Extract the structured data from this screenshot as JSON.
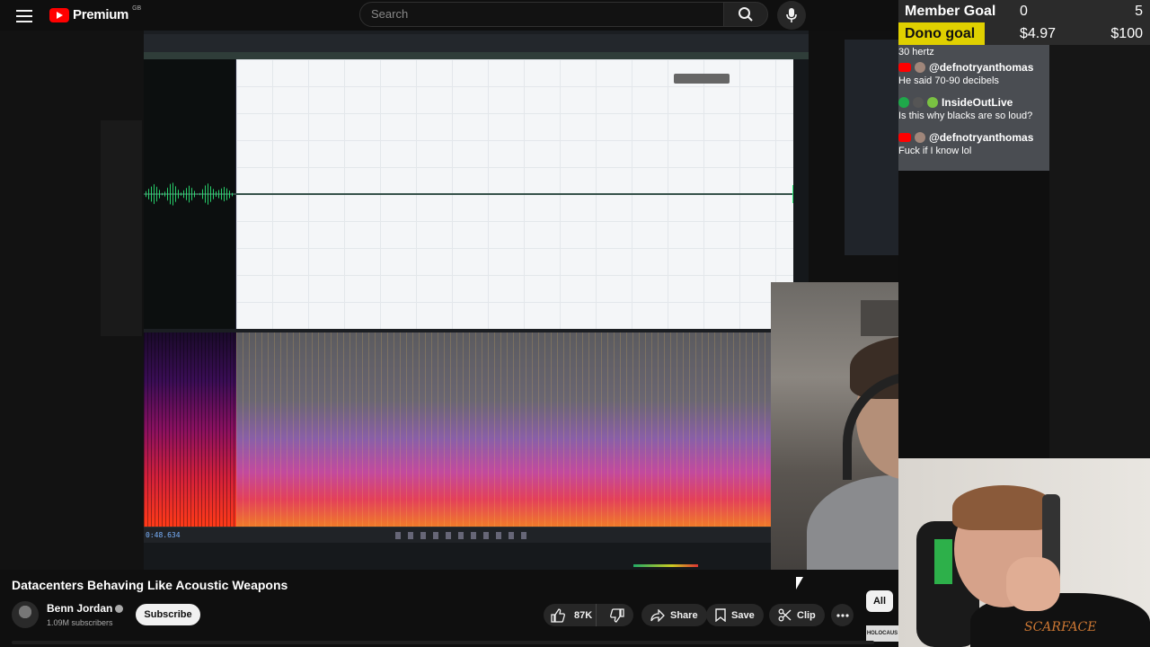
{
  "header": {
    "logo_text": "Premium",
    "region": "GB",
    "search_placeholder": "Search"
  },
  "video_overlay": {
    "timecode": "0:48.634",
    "member_goal": {
      "label": "Member Goal",
      "current": "0",
      "target": "5"
    },
    "dono_goal": {
      "label": "Dono goal",
      "current": "$4.97",
      "target": "$100",
      "progress_fraction": 0.05
    },
    "chat": {
      "top_line": "30 hertz",
      "messages": [
        {
          "user": "@defnotryanthomas",
          "text": "He said 70-90 decibels",
          "platform": "youtube"
        },
        {
          "user": "InsideOutLive",
          "text": "Is this why blacks are so loud?",
          "platform": "xbox"
        },
        {
          "user": "@defnotryanthomas",
          "text": "Fuck if I know lol",
          "platform": "youtube"
        }
      ]
    },
    "shirt_text": "SCARFACE"
  },
  "video_info": {
    "title": "Datacenters Behaving Like Acoustic Weapons",
    "channel": "Benn Jordan",
    "subscribers": "1.09M subscribers",
    "subscribe_label": "Subscribe",
    "likes": "87K",
    "share_label": "Share",
    "save_label": "Save",
    "clip_label": "Clip",
    "chip_all": "All",
    "thumb_text": "HOLOCAUS"
  },
  "colors": {
    "youtube_red": "#ff0000",
    "goal_yellow": "#e0d000",
    "background": "#0f0f0f"
  }
}
